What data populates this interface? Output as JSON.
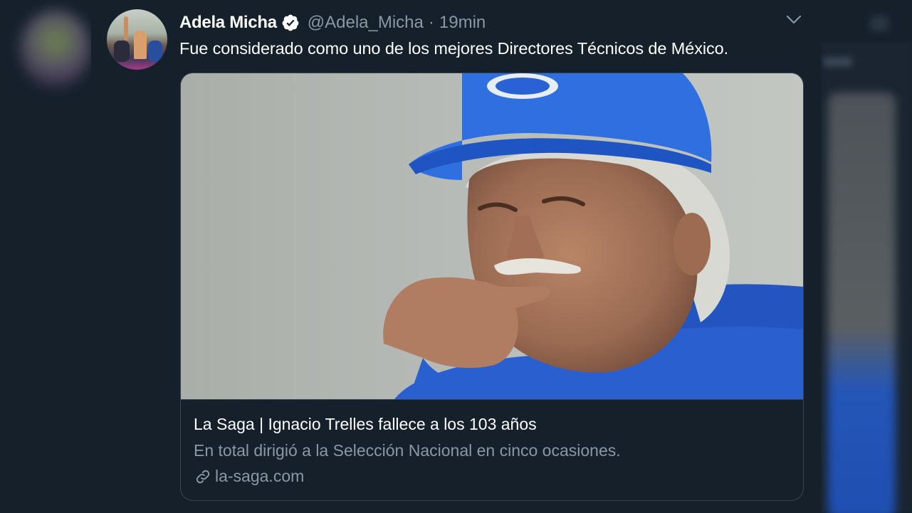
{
  "tweet": {
    "author_name": "Adela Micha",
    "author_handle": "@Adela_Micha",
    "separator": "·",
    "timestamp": "19min",
    "verified": true,
    "text": "Fue considerado como uno de los mejores Directores Técnicos de México.",
    "avatar_icon": "user-avatar",
    "menu_icon": "chevron-down-icon"
  },
  "card": {
    "image_description": "photo",
    "title": "La Saga | Ignacio Trelles fallece a los 103 años",
    "description": "En total dirigió a la Selección Nacional en cinco ocasiones.",
    "domain": "la-saga.com",
    "link_icon": "link-icon"
  },
  "colors": {
    "background": "#15202b",
    "secondary_text": "#8899a6",
    "border": "#38444d",
    "verified_badge": "#ffffff"
  }
}
